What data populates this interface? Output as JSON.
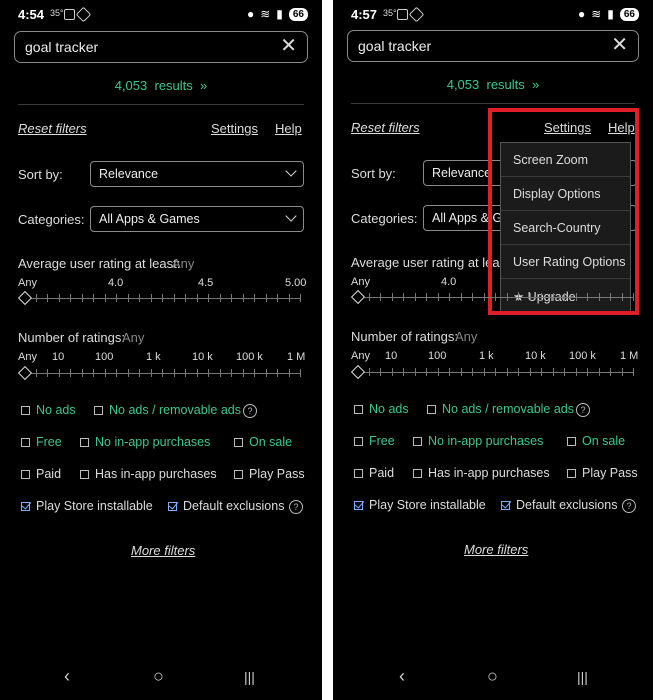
{
  "left": {
    "status": {
      "time": "4:54",
      "temp": "35°",
      "battery": "66"
    },
    "search": {
      "value": "goal tracker"
    },
    "results": {
      "count": "4,053",
      "word": "results"
    },
    "top_links": {
      "reset": "Reset filters",
      "settings": "Settings",
      "help": "Help"
    },
    "sort": {
      "label": "Sort by:",
      "value": "Relevance"
    },
    "categories": {
      "label": "Categories:",
      "value": "All Apps & Games"
    },
    "rating": {
      "label": "Average user rating at least:",
      "any": "Any",
      "ticks": [
        "Any",
        "4.0",
        "4.5",
        "5.00"
      ],
      "selected": "Any"
    },
    "num_ratings": {
      "label": "Number of ratings:",
      "any": "Any",
      "ticks": [
        "Any",
        "10",
        "100",
        "1 k",
        "10 k",
        "100 k",
        "1 M"
      ],
      "selected": "Any"
    },
    "checks": {
      "no_ads": "No ads",
      "no_ads_removable": "No ads / removable ads",
      "free": "Free",
      "no_iap": "No in-app purchases",
      "on_sale": "On sale",
      "paid": "Paid",
      "has_iap": "Has in-app purchases",
      "play_pass": "Play Pass",
      "installable": "Play Store installable",
      "default_excl": "Default exclusions"
    },
    "more_filters": "More filters"
  },
  "right": {
    "status": {
      "time": "4:57",
      "temp": "35°",
      "battery": "66"
    },
    "search": {
      "value": "goal tracker"
    },
    "results": {
      "count": "4,053",
      "word": "results"
    },
    "top_links": {
      "reset": "Reset filters",
      "settings": "Settings",
      "help": "Help"
    },
    "sort": {
      "label": "Sort by:",
      "value": "Relevance"
    },
    "categories": {
      "label": "Categories:",
      "value": "All Apps & Ga"
    },
    "rating": {
      "label": "Average user rating at least:",
      "any": "Any",
      "ticks": [
        "Any",
        "4.0"
      ],
      "selected": "Any"
    },
    "num_ratings": {
      "label": "Number of ratings:",
      "any": "Any",
      "ticks": [
        "Any",
        "10",
        "100",
        "1 k",
        "10 k",
        "100 k",
        "1 M"
      ],
      "selected": "Any"
    },
    "checks": {
      "no_ads": "No ads",
      "no_ads_removable": "No ads / removable ads",
      "free": "Free",
      "no_iap": "No in-app purchases",
      "on_sale": "On sale",
      "paid": "Paid",
      "has_iap": "Has in-app purchases",
      "play_pass": "Play Pass",
      "installable": "Play Store installable",
      "default_excl": "Default exclusions"
    },
    "more_filters": "More filters",
    "menu": {
      "items": [
        "Screen Zoom",
        "Display Options",
        "Search-Country",
        "User Rating Options",
        "★ Upgrade"
      ]
    }
  },
  "colors": {
    "accent": "#3ec78a",
    "highlight": "#e01e2a",
    "checked": "#7ab0ff",
    "background": "#000000"
  },
  "icons": {
    "clear": "close-icon",
    "chevrons": "double-chevron-right-icon",
    "dropdown": "chevron-down-icon",
    "help": "help-circle-icon"
  }
}
